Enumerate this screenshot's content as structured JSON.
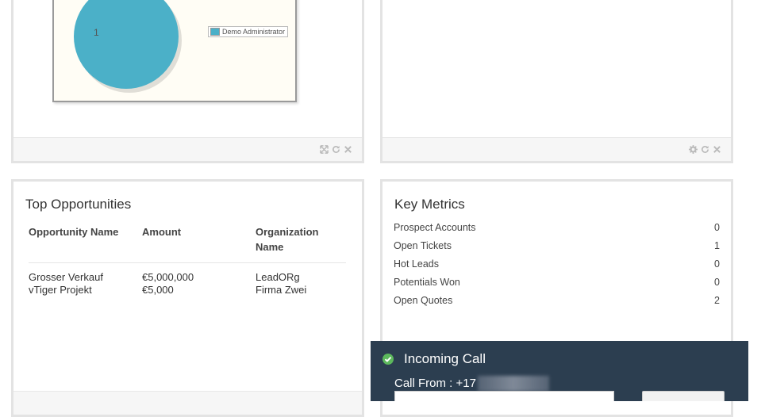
{
  "pie_widget": {
    "chart_data": {
      "type": "pie",
      "slices": [
        {
          "label": "Demo Administrator",
          "value": 1,
          "color": "#4bb0c8"
        }
      ],
      "data_label": "1",
      "legend": [
        "Demo Administrator"
      ]
    },
    "footer_icons": [
      "expand-icon",
      "refresh-icon",
      "close-icon"
    ]
  },
  "empty_widget": {
    "footer_icons": [
      "settings-icon",
      "refresh-icon",
      "close-icon"
    ]
  },
  "top_opportunities": {
    "title": "Top Opportunities",
    "columns": [
      "Opportunity Name",
      "Amount",
      "Organization Name"
    ],
    "rows": [
      {
        "name": "Grosser Verkauf",
        "amount": "€5,000,000",
        "organization": "LeadORg"
      },
      {
        "name": "vTiger Projekt",
        "amount": "€5,000",
        "organization": "Firma Zwei"
      }
    ]
  },
  "key_metrics": {
    "title": "Key Metrics",
    "items": [
      {
        "label": "Prospect Accounts",
        "value": "0"
      },
      {
        "label": "Open Tickets",
        "value": "1"
      },
      {
        "label": "Hot Leads",
        "value": "0"
      },
      {
        "label": "Potentials Won",
        "value": "0"
      },
      {
        "label": "Open Quotes",
        "value": "2"
      }
    ]
  },
  "incoming_call": {
    "title": "Incoming Call",
    "from_label": "Call From : +17",
    "status_color": "#5cb85c",
    "background_color": "#2c3e50"
  }
}
